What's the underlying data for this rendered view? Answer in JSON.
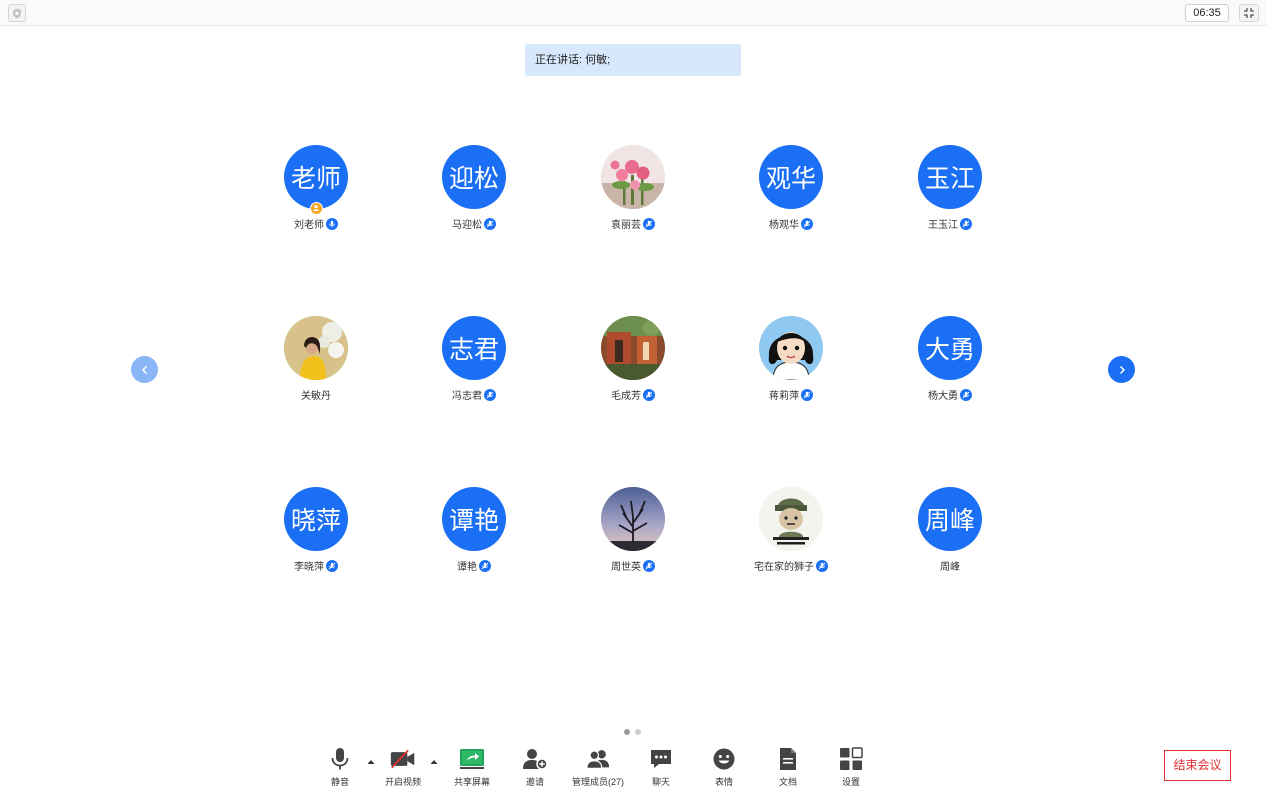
{
  "titlebar": {
    "timer": "06:35"
  },
  "speaking": "正在讲话: 何敏;",
  "participants": [
    {
      "avatar_text": "老师",
      "name": "刘老师",
      "photo": "",
      "host": true,
      "mic": true
    },
    {
      "avatar_text": "迎松",
      "name": "马迎松",
      "photo": "",
      "host": false,
      "mic": true
    },
    {
      "avatar_text": "",
      "name": "袁丽芸",
      "photo": "flowers",
      "host": false,
      "mic": true
    },
    {
      "avatar_text": "观华",
      "name": "杨观华",
      "photo": "",
      "host": false,
      "mic": true
    },
    {
      "avatar_text": "玉江",
      "name": "王玉江",
      "photo": "",
      "host": false,
      "mic": true
    },
    {
      "avatar_text": "",
      "name": "关敏丹",
      "photo": "woman",
      "host": false,
      "mic": false
    },
    {
      "avatar_text": "志君",
      "name": "冯志君",
      "photo": "",
      "host": false,
      "mic": true
    },
    {
      "avatar_text": "",
      "name": "毛成芳",
      "photo": "garden",
      "host": false,
      "mic": true
    },
    {
      "avatar_text": "",
      "name": "蒋莉萍",
      "photo": "cartoon",
      "host": false,
      "mic": true
    },
    {
      "avatar_text": "大勇",
      "name": "杨大勇",
      "photo": "",
      "host": false,
      "mic": true
    },
    {
      "avatar_text": "晓萍",
      "name": "李晓萍",
      "photo": "",
      "host": false,
      "mic": true
    },
    {
      "avatar_text": "谭艳",
      "name": "谭艳",
      "photo": "",
      "host": false,
      "mic": true
    },
    {
      "avatar_text": "",
      "name": "周世英",
      "photo": "tree",
      "host": false,
      "mic": true
    },
    {
      "avatar_text": "",
      "name": "宅在家的狮子",
      "photo": "meme",
      "host": false,
      "mic": true
    },
    {
      "avatar_text": "周峰",
      "name": "周峰",
      "photo": "",
      "host": false,
      "mic": false
    }
  ],
  "toolbar": {
    "mute": "静音",
    "video": "开启视频",
    "share": "共享屏幕",
    "invite": "邀请",
    "members": "管理成员(27)",
    "chat": "聊天",
    "emoji": "表情",
    "docs": "文档",
    "settings": "设置"
  },
  "end_meeting": "结束会议",
  "colors": {
    "accent": "#1a6ff5",
    "end": "#e23030",
    "speaking_bg": "#d8e8fc",
    "host_badge": "#f5a623"
  }
}
